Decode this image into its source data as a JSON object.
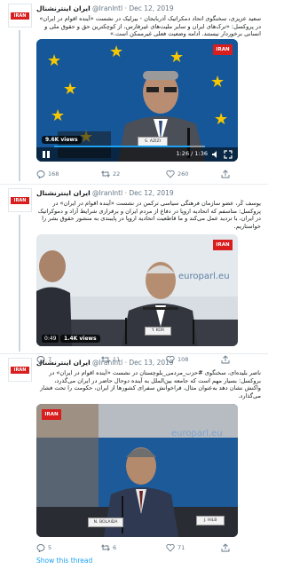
{
  "tweets": [
    {
      "name": "ایران اینترنشنال",
      "handle": "@IranIntl",
      "date": "Dec 12, 2019",
      "avatar_label": "IRAN",
      "text": "سعید عزیزی، سخنگوی اتحاد دمکراتیک آذربایجان - بیرلیک در نشست «آینده اقوام در ایران» در پروکسل: «ترک‌های ایران و سایر ملیت‌های غیرفارس، از کوچکترین حق و حقوق ملی و انسانی برخوردار نیستند. ادامه وضعیت فعلی غیرممکن است.»",
      "video": {
        "views": "9.6K views",
        "time": "1:26 / 1:36",
        "channel_tag": "IRAN",
        "nameplate": "S. AZIZI"
      },
      "counts": {
        "replies": "168",
        "retweets": "22",
        "likes": "260"
      }
    },
    {
      "name": "ایران اینترنشنال",
      "handle": "@IranIntl",
      "date": "Dec 12, 2019",
      "avatar_label": "IRAN",
      "text": "یوسف کُر، عضو سازمان فرهنگی سیاسی ترکمن در نشست «آینده اقوام در ایران» در پروکسل: متاسفم که اتحادیه اروپا در دفاع از مردم ایران و برقراری شرایط آزاد و دموکراتیک در ایران، با تردید عمل می‌کند و ما قاطعیت اتحادیه اروپا در پایبندی به منشور حقوق بشر را خواستاریم.",
      "video": {
        "views": "1.4K views",
        "time": "0:49",
        "channel_tag": "IRAN",
        "nameplate": "Y. KOR",
        "backdrop": "europarl.eu"
      },
      "counts": {
        "replies": "7",
        "retweets": "11",
        "likes": "108"
      }
    },
    {
      "name": "ایران اینترنشنال",
      "handle": "@IranIntl",
      "date": "Dec 13, 2019",
      "avatar_label": "IRAN",
      "text": "ناصر بلیده‌ای، سخنگوی #حزب_مردمی_بلوچستان در نشست «آینده اقوام در ایران» در بروکسل: بسیار مهم است که جامعه بین‌الملل به آینده دو‌حال حاضر در ایران می‌گذرد، واکنش نشان دهد به‌عنوان مثال، فراخوانش سفرای کشورها از ایران، حکومت را تحت فشار می‌گذارد.",
      "video": {
        "channel_tag": "IRAN",
        "nameplate": "N. BOLAIDA",
        "nameplate2": "J. HILB",
        "backdrop": "europarl.eu"
      },
      "counts": {
        "replies": "5",
        "retweets": "6",
        "likes": "71"
      }
    }
  ],
  "show_thread": "Show this thread",
  "colors": {
    "brand_red": "#d81e1e",
    "link": "#1da1f2",
    "meta": "#657786",
    "eu_blue": "#16579a"
  }
}
